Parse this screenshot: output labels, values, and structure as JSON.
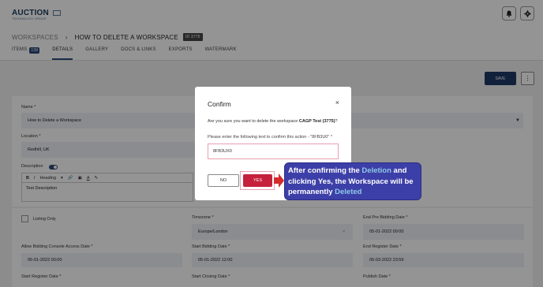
{
  "header": {
    "logo_text": "AUCTION",
    "logo_sub": "TECHNOLOGY GROUP",
    "notification_icon": "bell-icon",
    "settings_icon": "gear-icon"
  },
  "breadcrumb": {
    "root": "WORKSPACES",
    "separator": "›",
    "current": "HOW TO DELETE A WORKSPACE",
    "id_badge": "ID 3775"
  },
  "tabs": [
    {
      "label": "ITEMS",
      "badge": "139"
    },
    {
      "label": "DETAILS"
    },
    {
      "label": "GALLERY"
    },
    {
      "label": "DOCS & LINKS"
    },
    {
      "label": "EXPORTS"
    },
    {
      "label": "WATERMARK"
    }
  ],
  "toolbar": {
    "save_label": "SAVE",
    "more_icon": "more-vertical-icon"
  },
  "form": {
    "name_label": "Name *",
    "name_value": "How to Delete a Workspace",
    "location_label": "Location *",
    "location_value": "Redhill, UK",
    "description_label": "Description",
    "editor_format": "Heading",
    "editor_text": "Test Description",
    "listing_only_label": "Listing Only",
    "timezone_label": "Timezone *",
    "timezone_value": "Europe/London",
    "end_pre_bidding_label": "End Pre Bidding Date *",
    "end_pre_bidding_value": "05-01-2022 00:00",
    "allow_console_label": "Allow Bidding Console Access Date *",
    "allow_console_value": "05-01-2022 00:00",
    "start_bidding_label": "Start Bidding Date *",
    "start_bidding_value": "05-01-2022 12:00",
    "end_register_label": "End Register Date *",
    "end_register_value": "05-03-2022 23:59",
    "start_register_label": "Start Register Date *",
    "start_closing_label": "Start Closing Date *",
    "publish_label": "Publish Date *"
  },
  "modal": {
    "title": "Confirm",
    "close": "×",
    "question_prefix": "Are you sure you want to delete the workspace ",
    "workspace_name": "CAGP Test (3775)",
    "question_suffix": "?",
    "hint": "Please enter the following text to confirm this action - \"8FB3U0\" *",
    "input_value": "8FB3UX0",
    "no_label": "NO",
    "yes_label": "YES"
  },
  "callout": {
    "part1": "After confirming  the ",
    "part2": "Deletion",
    "part3": " and clicking Yes, the Workspace will be permanently ",
    "part4": "Deleted"
  },
  "colors": {
    "primary": "#1e3a66",
    "danger": "#c5213c",
    "callout_bg": "#3d3fa8",
    "highlight": "#8fc9e6"
  }
}
